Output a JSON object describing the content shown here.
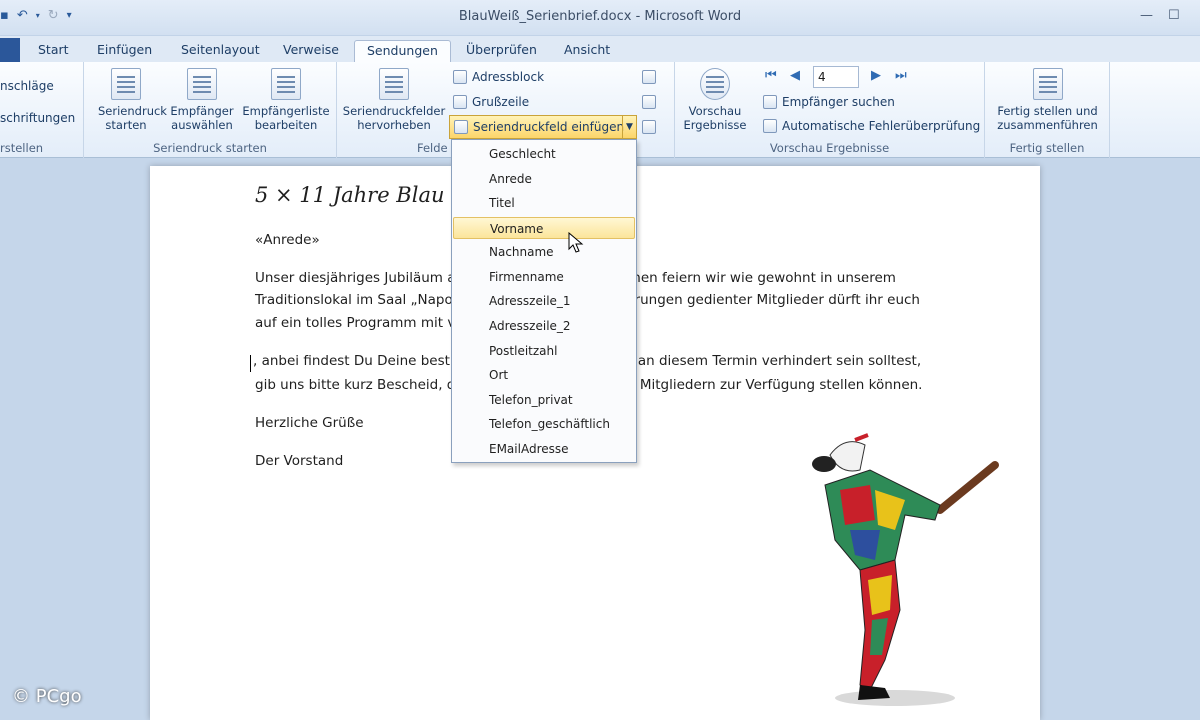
{
  "window": {
    "title": "BlauWeiß_Serienbrief.docx - Microsoft Word"
  },
  "tabs": [
    "Start",
    "Einfügen",
    "Seitenlayout",
    "Verweise",
    "Sendungen",
    "Überprüfen",
    "Ansicht"
  ],
  "active_tab": "Sendungen",
  "ribbon": {
    "create_group": {
      "item1": "nschläge",
      "item2": "schriftungen",
      "label": "rstellen"
    },
    "start_group": {
      "label": "Seriendruck starten",
      "btn1": "Seriendruck starten",
      "btn2": "Empfänger auswählen",
      "btn3": "Empfängerliste bearbeiten"
    },
    "fields_group": {
      "label": "Felde",
      "highlight_btn": "Seriendruckfelder hervorheben",
      "address_block": "Adressblock",
      "greeting_line": "Grußzeile",
      "insert_field": "Seriendruckfeld einfügen"
    },
    "preview_group": {
      "label": "Vorschau Ergebnisse",
      "preview_btn": "Vorschau Ergebnisse",
      "record_number": "4",
      "find_recipient": "Empfänger suchen",
      "auto_check": "Automatische Fehlerüberprüfung"
    },
    "finish_group": {
      "label": "Fertig stellen",
      "finish_btn": "Fertig stellen und zusammenführen"
    }
  },
  "menu_items": [
    "Geschlecht",
    "Anrede",
    "Titel",
    "Vorname",
    "Nachname",
    "Firmenname",
    "Adresszeile_1",
    "Adresszeile_2",
    "Postleitzahl",
    "Ort",
    "Telefon_privat",
    "Telefon_geschäftlich",
    "EMailAdresse"
  ],
  "hovered_item": "Vorname",
  "document": {
    "title": "5 × 11 Jahre Blau W",
    "salutation": "«Anrede»",
    "p1_l1_a": "Unser diesjähriges Jubiläum a",
    "p1_l1_b": "ehen feiern wir wie gewohnt in unserem",
    "p1_l2_a": "Traditionslokal im Saal „Napo",
    "p1_l2_b": "hrungen gedienter Mitglieder dürft ihr euch",
    "p1_l3_a": "auf ein tolles Programm mit v",
    "p2_l1_a": ", anbei findest Du Deine best",
    "p2_l1_b": "u an diesem Termin verhindert sein solltest,",
    "p2_l2_a": "gib uns bitte kurz Bescheid, d",
    "p2_l2_b": "n Mitgliedern zur Verfügung stellen können.",
    "closing": "Herzliche Grüße",
    "signature": "Der Vorstand"
  },
  "watermark": "© PCgo"
}
